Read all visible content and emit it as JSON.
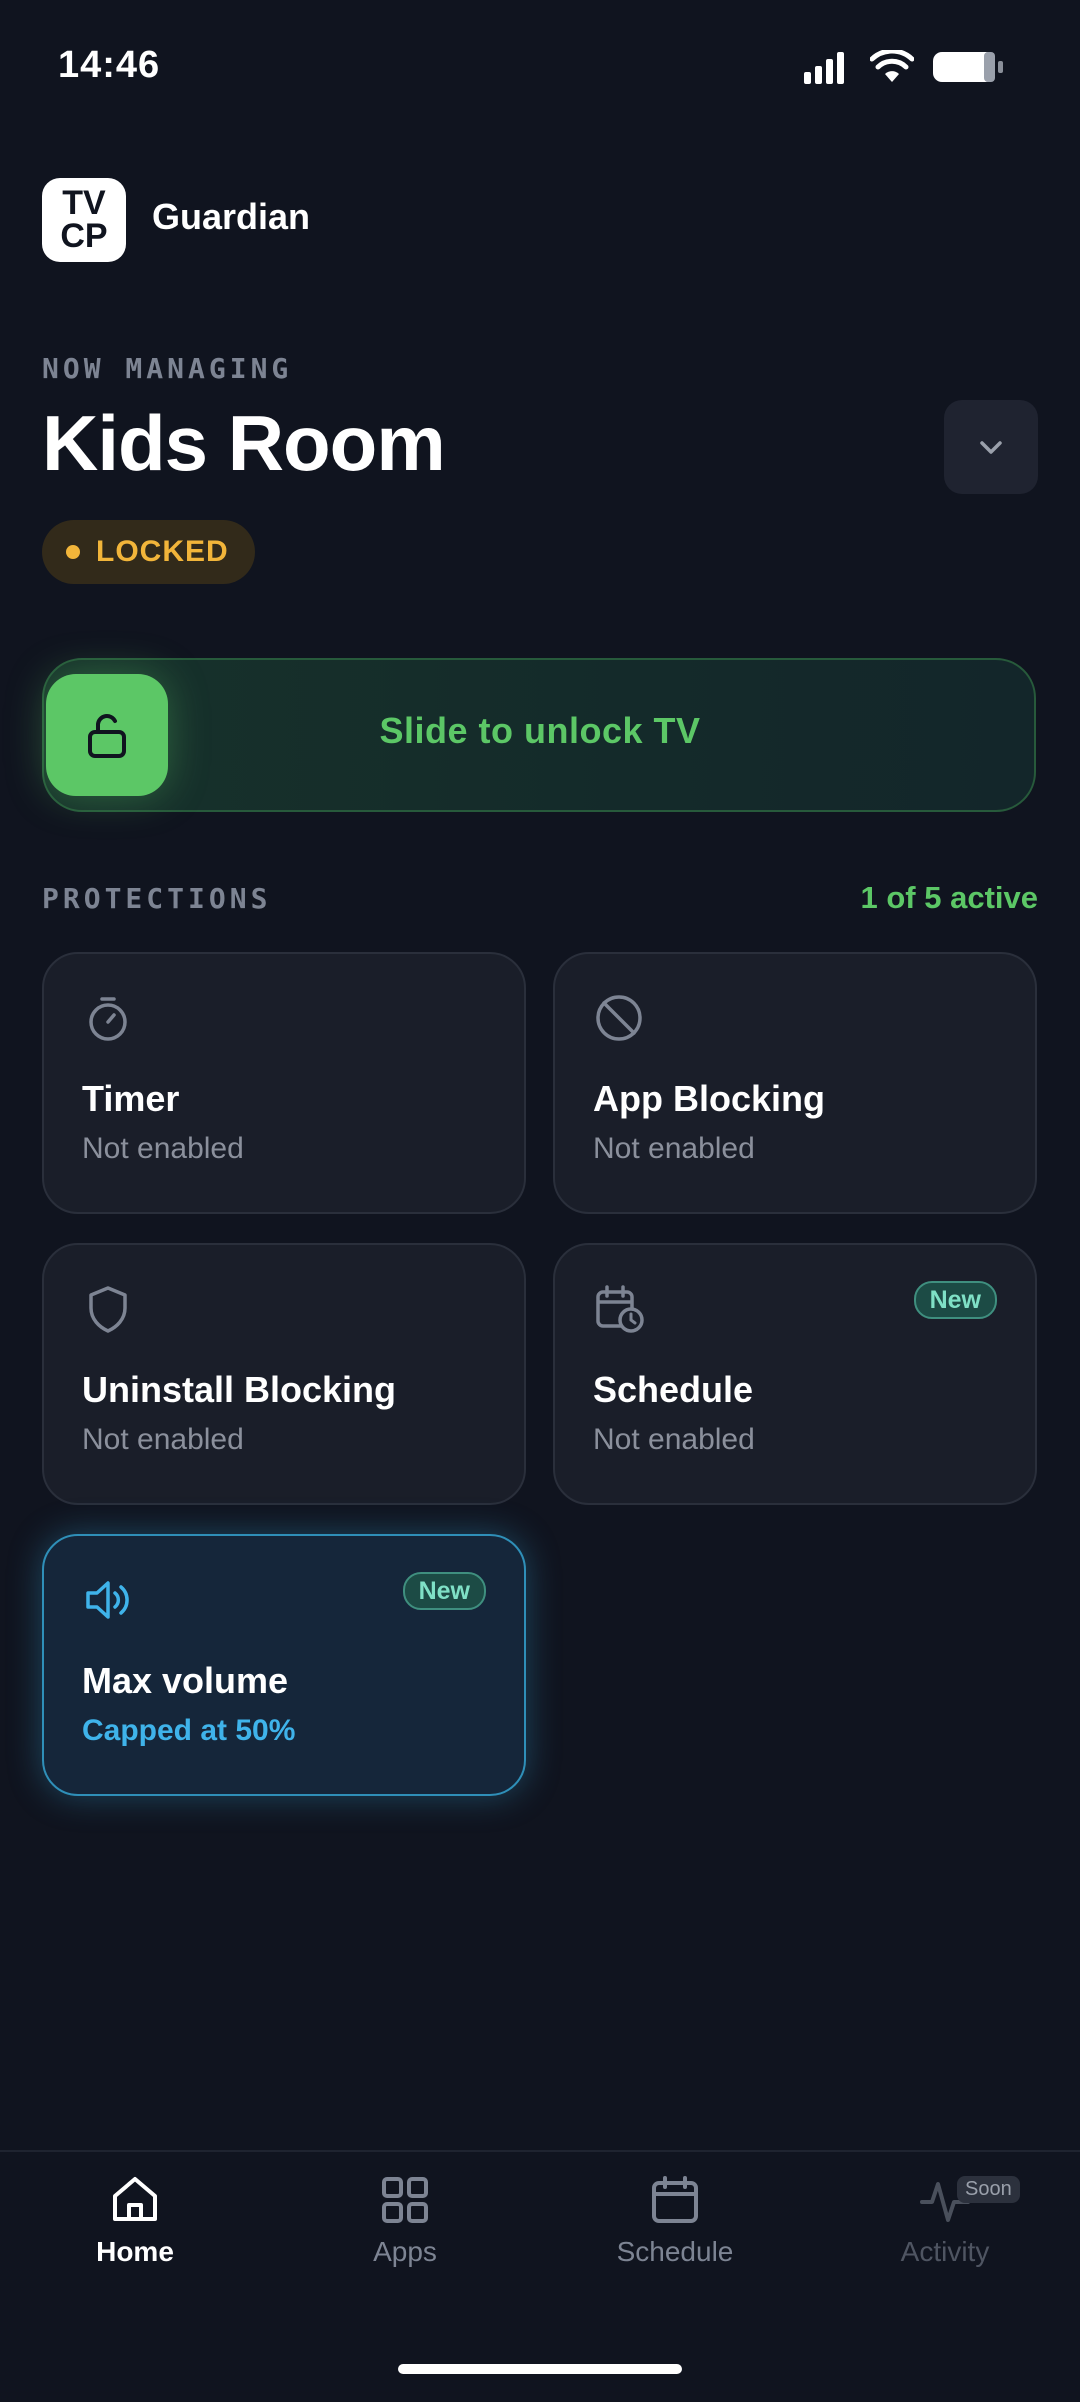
{
  "status_bar": {
    "time": "14:46"
  },
  "header": {
    "logo_line1": "TV",
    "logo_line2": "CP",
    "app_name": "Guardian"
  },
  "device": {
    "eyebrow": "NOW MANAGING",
    "name": "Kids Room",
    "status": "LOCKED",
    "status_color": "#f2b53a"
  },
  "unlock_slider": {
    "label": "Slide to unlock TV",
    "accent": "#5cc766"
  },
  "protections": {
    "heading": "PROTECTIONS",
    "active_count": "1 of 5 active",
    "cards": [
      {
        "title": "Timer",
        "subtitle": "Not enabled",
        "icon": "stopwatch-icon",
        "badge": ""
      },
      {
        "title": "App Blocking",
        "subtitle": "Not enabled",
        "icon": "block-icon",
        "badge": ""
      },
      {
        "title": "Uninstall Blocking",
        "subtitle": "Not enabled",
        "icon": "shield-icon",
        "badge": ""
      },
      {
        "title": "Schedule",
        "subtitle": "Not enabled",
        "icon": "calendar-clock-icon",
        "badge": "New"
      },
      {
        "title": "Max volume",
        "subtitle": "Capped at 50%",
        "icon": "volume-icon",
        "badge": "New"
      }
    ]
  },
  "bottom_nav": {
    "items": [
      {
        "label": "Home",
        "icon": "home-icon",
        "active": true
      },
      {
        "label": "Apps",
        "icon": "grid-icon",
        "active": false
      },
      {
        "label": "Schedule",
        "icon": "calendar-icon",
        "active": false
      },
      {
        "label": "Activity",
        "icon": "activity-icon",
        "active": false,
        "badge": "Soon"
      }
    ]
  }
}
